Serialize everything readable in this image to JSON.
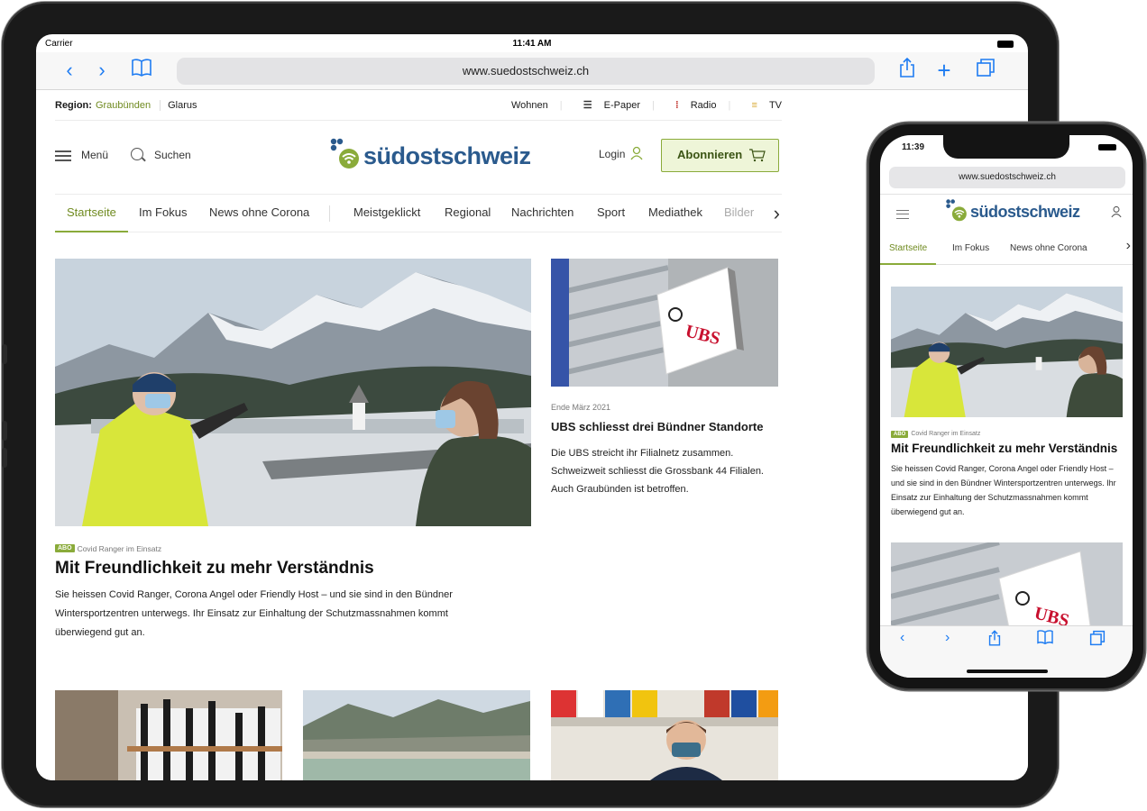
{
  "tablet": {
    "status": {
      "carrier": "Carrier",
      "time": "11:41 AM"
    },
    "browser": {
      "url": "www.suedostschweiz.ch"
    },
    "topbar": {
      "region_label": "Region:",
      "region_active": "Graubünden",
      "region_other": "Glarus",
      "links": [
        "Wohnen",
        "E-Paper",
        "Radio",
        "TV"
      ]
    },
    "header": {
      "menu_label": "Menü",
      "search_label": "Suchen",
      "logo_text": "südostschweiz",
      "login_label": "Login",
      "subscribe_label": "Abonnieren"
    },
    "nav": {
      "items": [
        "Startseite",
        "Im Fokus",
        "News ohne Corona",
        "Meistgeklickt",
        "Regional",
        "Nachrichten",
        "Sport",
        "Mediathek",
        "Bilder"
      ]
    },
    "hero": {
      "badge": "ABO",
      "kicker": "Covid Ranger im Einsatz",
      "title": "Mit Freundlichkeit zu mehr Verständnis",
      "text": "Sie heissen Covid Ranger, Corona Angel oder Friendly Host – und sie sind in den Bündner Wintersportzentren unterwegs. Ihr Einsatz zur Einhaltung der Schutzmassnahmen kommt überwiegend gut an."
    },
    "side_story": {
      "date": "Ende März 2021",
      "title": "UBS schliesst drei Bündner Standorte",
      "text": "Die UBS streicht ihr Filialnetz zusammen. Schweizweit schliesst die Grossbank 44 Filialen. Auch Graubünden ist betroffen.",
      "sign_text": "UBS"
    }
  },
  "phone": {
    "status": {
      "time": "11:39"
    },
    "browser": {
      "url": "www.suedostschweiz.ch"
    },
    "logo_text": "südostschweiz",
    "nav": {
      "items": [
        "Startseite",
        "Im Fokus",
        "News ohne Corona"
      ]
    },
    "hero": {
      "badge": "ABO",
      "kicker": "Covid Ranger im Einsatz",
      "title": "Mit Freundlichkeit zu mehr Verständnis",
      "text": "Sie heissen Covid Ranger, Corona Angel oder Friendly Host – und sie sind in den Bündner Wintersportzentren unterwegs. Ihr Einsatz zur Einhaltung der Schutzmassnahmen kommt überwiegend gut an."
    },
    "second_story": {
      "sign_text": "UBS"
    }
  },
  "colors": {
    "accent_green": "#8aab3a",
    "logo_blue": "#2a5a8d",
    "safari_blue": "#1e7cf2"
  }
}
